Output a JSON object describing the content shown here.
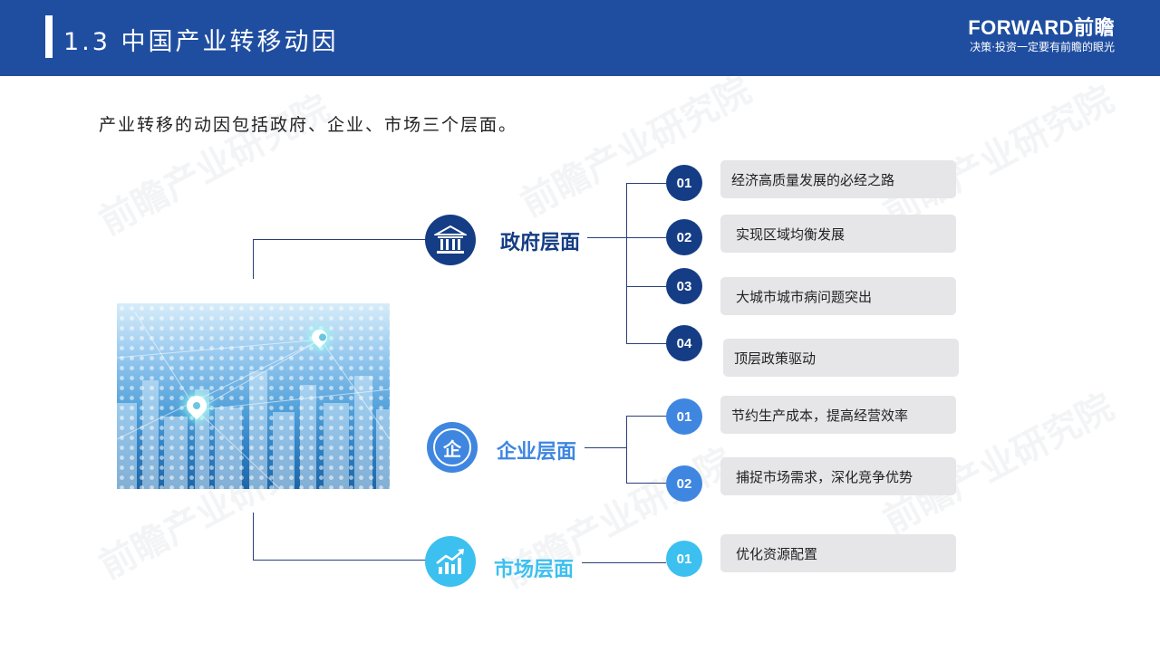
{
  "header": {
    "title": "1.3  中国产业转移动因",
    "logo_brand": "FORWARD前瞻",
    "logo_slogan": "决策·投资一定要有前瞻的眼光"
  },
  "watermark": "前瞻产业研究院",
  "intro": "产业转移的动因包括政府、企业、市场三个层面。",
  "colors": {
    "header": "#1f4ea1",
    "government": "#153d85",
    "enterprise": "#3f86e0",
    "market": "#3cc0ef",
    "item_bg": "#e6e6e8"
  },
  "categories": [
    {
      "label": "政府层面",
      "icon": "government-building-icon",
      "items": [
        {
          "num": "01",
          "text": "经济高质量发展的必经之路"
        },
        {
          "num": "02",
          "text": "实现区域均衡发展"
        },
        {
          "num": "03",
          "text": "大城市城市病问题突出"
        },
        {
          "num": "04",
          "text": "顶层政策驱动"
        }
      ]
    },
    {
      "label": "企业层面",
      "icon": "enterprise-icon",
      "icon_text": "企",
      "items": [
        {
          "num": "01",
          "text": "节约生产成本，提高经营效率"
        },
        {
          "num": "02",
          "text": "捕捉市场需求，深化竞争优势"
        }
      ]
    },
    {
      "label": "市场层面",
      "icon": "market-growth-chart-icon",
      "items": [
        {
          "num": "01",
          "text": "优化资源配置"
        }
      ]
    }
  ]
}
